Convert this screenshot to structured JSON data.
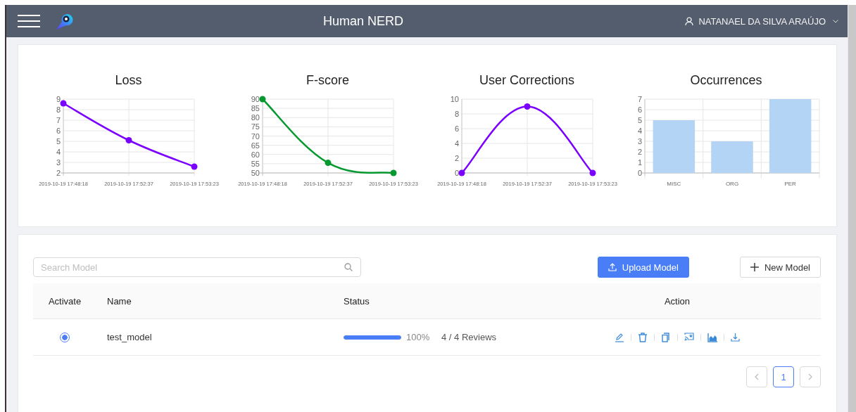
{
  "header": {
    "title": "Human NERD",
    "user": "NATANAEL DA SILVA ARAÚJO"
  },
  "charts": [
    {
      "chart_data": {
        "type": "line",
        "title": "Loss",
        "categories": [
          "2019-10-19 17:48:18",
          "2019-10-19 17:52:37",
          "2019-10-19 17:53:23"
        ],
        "ylim": [
          2,
          9
        ],
        "yticks": [
          2,
          3,
          4,
          5,
          6,
          7,
          8,
          9
        ],
        "grid": true,
        "series": [
          {
            "color": "#7a00ff",
            "marker": true,
            "values": [
              8.6,
              5.1,
              2.6
            ]
          }
        ]
      }
    },
    {
      "chart_data": {
        "type": "line",
        "title": "F-score",
        "categories": [
          "2019-10-19 17:48:18",
          "2019-10-19 17:52:37",
          "2019-10-19 17:53:23"
        ],
        "ylim": [
          50,
          90
        ],
        "yticks": [
          50,
          55,
          60,
          65,
          70,
          75,
          80,
          85,
          90
        ],
        "grid": true,
        "series": [
          {
            "color": "#06992f",
            "marker": true,
            "values": [
              90,
              55.5,
              50
            ]
          }
        ]
      }
    },
    {
      "chart_data": {
        "type": "line",
        "title": "User Corrections",
        "categories": [
          "2019-10-19 17:48:18",
          "2019-10-19 17:52:37",
          "2019-10-19 17:53:23"
        ],
        "ylim": [
          0,
          10
        ],
        "yticks": [
          0,
          2,
          4,
          6,
          8,
          10
        ],
        "grid": true,
        "series": [
          {
            "color": "#7a00ff",
            "marker": true,
            "values": [
              0,
              9,
              0
            ]
          }
        ]
      }
    },
    {
      "chart_data": {
        "type": "bar",
        "title": "Occurrences",
        "categories": [
          "MISC",
          "ORG",
          "PER"
        ],
        "ylim": [
          0,
          7
        ],
        "yticks": [
          0,
          1,
          2,
          3,
          4,
          5,
          6,
          7
        ],
        "grid": true,
        "series": [
          {
            "color": "#b3d4f5",
            "values": [
              5,
              3,
              7
            ]
          }
        ]
      }
    }
  ],
  "models": {
    "search": {
      "placeholder": "Search Model"
    },
    "buttons": [
      {
        "label": "Upload Model",
        "kind": "primary"
      },
      {
        "label": "New Model",
        "kind": "default"
      }
    ],
    "columns": [
      "Activate",
      "Name",
      "Status",
      "Action"
    ],
    "rows": [
      {
        "selected": true,
        "name": "test_model",
        "level": 1,
        "percent": "100%",
        "reviews": "4 / 4 Reviews"
      }
    ],
    "pages": [
      {
        "label": "1",
        "selected": true
      }
    ]
  }
}
